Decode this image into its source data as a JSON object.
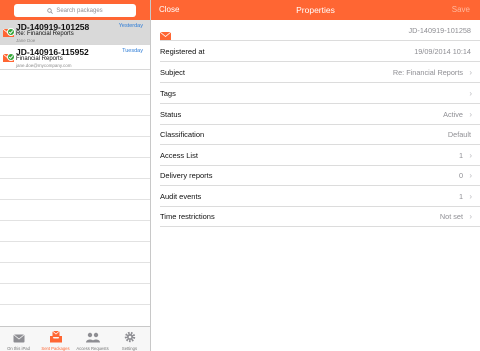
{
  "sidebar": {
    "search_placeholder": "Search packages",
    "packages": [
      {
        "id": "JD-140919-101258",
        "date": "Yesterday",
        "subject": "Re: Financial Reports",
        "from": "Jane Doe"
      },
      {
        "id": "JD-140916-115952",
        "date": "Tuesday",
        "subject": "Financial Reports",
        "from": "jane.doe@mycompany.com"
      }
    ]
  },
  "tabbar": {
    "tabs": [
      {
        "label": "On this iPad",
        "icon": "envelope-icon"
      },
      {
        "label": "Sent Packages",
        "icon": "outbox-tray-icon"
      },
      {
        "label": "Access Requests",
        "icon": "people-icon"
      },
      {
        "label": "Settings",
        "icon": "gear-icon"
      }
    ]
  },
  "navbar": {
    "close": "Close",
    "title": "Properties",
    "save": "Save"
  },
  "properties": {
    "package_id": "JD-140919-101258",
    "rows": [
      {
        "label": "Registered at",
        "value": "19/09/2014 10:14"
      },
      {
        "label": "Subject",
        "value": "Re: Financial Reports"
      },
      {
        "label": "Tags",
        "value": ""
      },
      {
        "label": "Status",
        "value": "Active"
      },
      {
        "label": "Classification",
        "value": "Default"
      },
      {
        "label": "Access List",
        "value": "1"
      },
      {
        "label": "Delivery reports",
        "value": "0"
      },
      {
        "label": "Audit events",
        "value": "1"
      },
      {
        "label": "Time restrictions",
        "value": "Not set"
      }
    ]
  },
  "colors": {
    "accent": "#ff6633",
    "link_blue": "#2b7bd6",
    "check_green": "#35a53a"
  }
}
